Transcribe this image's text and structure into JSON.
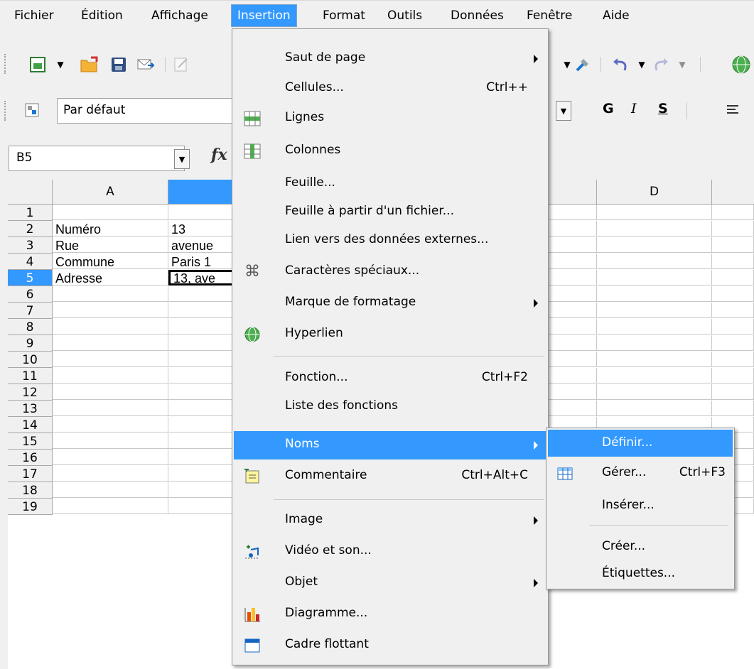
{
  "menubar": {
    "items": [
      "Fichier",
      "Édition",
      "Affichage",
      "Insertion",
      "Format",
      "Outils",
      "Données",
      "Fenêtre",
      "Aide"
    ],
    "active": "Insertion"
  },
  "format_toolbar": {
    "style_value": "Par défaut",
    "bold": "G",
    "italic": "I",
    "underline": "S"
  },
  "formula_bar": {
    "cell_ref": "B5",
    "fx": "fx"
  },
  "sheet": {
    "columns": [
      "A",
      "D"
    ],
    "rows": [
      "1",
      "2",
      "3",
      "4",
      "5",
      "6",
      "7",
      "8",
      "9",
      "10",
      "11",
      "12",
      "13",
      "14",
      "15",
      "16",
      "17",
      "18",
      "19"
    ],
    "cells": {
      "A2": "Numéro",
      "B2": "13",
      "A3": "Rue",
      "B3": "avenue",
      "A4": "Commune",
      "B4": "Paris 1",
      "A5": "Adresse",
      "B5": "13, ave"
    },
    "selected_row": "5"
  },
  "insert_menu": {
    "items": [
      {
        "label": "Saut de page",
        "shortcut": "",
        "submenu": true
      },
      {
        "label": "Cellules...",
        "shortcut": "Ctrl++",
        "submenu": false
      },
      {
        "label": "Lignes",
        "shortcut": "",
        "submenu": false
      },
      {
        "label": "Colonnes",
        "shortcut": "",
        "submenu": false
      },
      {
        "label": "Feuille...",
        "shortcut": "",
        "submenu": false
      },
      {
        "label": "Feuille à partir d'un fichier...",
        "shortcut": "",
        "submenu": false
      },
      {
        "label": "Lien vers des données externes...",
        "shortcut": "",
        "submenu": false
      },
      {
        "label": "Caractères spéciaux...",
        "shortcut": "",
        "submenu": false
      },
      {
        "label": "Marque de formatage",
        "shortcut": "",
        "submenu": true
      },
      {
        "label": "Hyperlien",
        "shortcut": "",
        "submenu": false
      },
      {
        "label": "Fonction...",
        "shortcut": "Ctrl+F2",
        "submenu": false
      },
      {
        "label": "Liste des fonctions",
        "shortcut": "",
        "submenu": false
      },
      {
        "label": "Noms",
        "shortcut": "",
        "submenu": true
      },
      {
        "label": "Commentaire",
        "shortcut": "Ctrl+Alt+C",
        "submenu": false
      },
      {
        "label": "Image",
        "shortcut": "",
        "submenu": true
      },
      {
        "label": "Vidéo et son...",
        "shortcut": "",
        "submenu": false
      },
      {
        "label": "Objet",
        "shortcut": "",
        "submenu": true
      },
      {
        "label": "Diagramme...",
        "shortcut": "",
        "submenu": false
      },
      {
        "label": "Cadre flottant",
        "shortcut": "",
        "submenu": false
      }
    ],
    "highlighted": "Noms"
  },
  "names_submenu": {
    "items": [
      {
        "label": "Définir...",
        "shortcut": ""
      },
      {
        "label": "Gérer...",
        "shortcut": "Ctrl+F3"
      },
      {
        "label": "Insérer...",
        "shortcut": ""
      },
      {
        "label": "Créer...",
        "shortcut": ""
      },
      {
        "label": "Étiquettes...",
        "shortcut": ""
      }
    ],
    "highlighted": "Définir..."
  },
  "colors": {
    "highlight": "#3399ff",
    "menu_bg": "#f0f0f0"
  }
}
